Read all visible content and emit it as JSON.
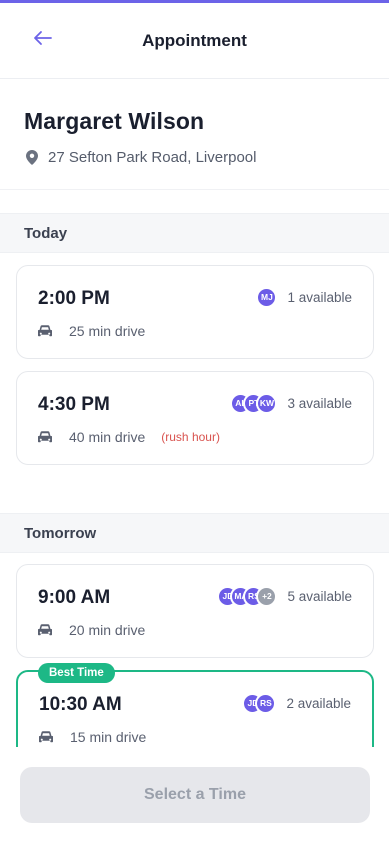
{
  "header": {
    "title": "Appointment"
  },
  "customer": {
    "name": "Margaret Wilson",
    "address": "27 Sefton Park Road, Liverpool"
  },
  "sections": [
    {
      "title": "Today",
      "slots": [
        {
          "time": "2:00 PM",
          "drive": "25 min drive",
          "note": "",
          "avatars": [
            "MJ"
          ],
          "available": "1 available"
        },
        {
          "time": "4:30 PM",
          "drive": "40 min drive",
          "note": "(rush hour)",
          "avatars": [
            "AL",
            "PT",
            "KW"
          ],
          "available": "3 available"
        }
      ]
    },
    {
      "title": "Tomorrow",
      "slots": [
        {
          "time": "9:00 AM",
          "drive": "20 min drive",
          "note": "",
          "avatars": [
            "JD",
            "MA",
            "RS",
            "+2"
          ],
          "available": "5 available"
        },
        {
          "time": "10:30 AM",
          "drive": "15 min drive",
          "note": "",
          "avatars": [
            "JD",
            "RS"
          ],
          "available": "2 available",
          "badge": "Best Time"
        }
      ]
    }
  ],
  "footer": {
    "cta_label": "Select a Time"
  },
  "colors": {
    "accent": "#6c63e8",
    "best": "#1db886",
    "rush": "#d9534f",
    "avatar": "#6c5ce7"
  }
}
